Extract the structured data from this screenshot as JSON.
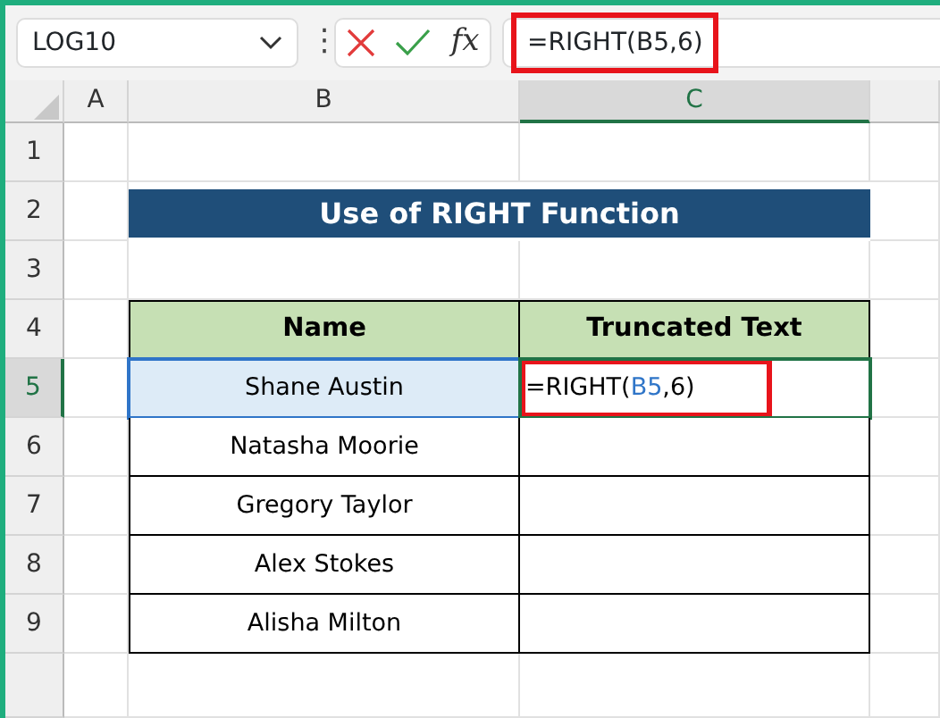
{
  "name_box": {
    "value": "LOG10"
  },
  "formula_bar": {
    "more": "⋮",
    "function_label": "fx",
    "value": "=RIGHT(B5,6)",
    "highlighted": true
  },
  "column_headers": [
    {
      "label": "A",
      "selected": false
    },
    {
      "label": "B",
      "selected": false
    },
    {
      "label": "C",
      "selected": true
    }
  ],
  "row_headers": [
    {
      "label": "1",
      "selected": false
    },
    {
      "label": "2",
      "selected": false
    },
    {
      "label": "3",
      "selected": false
    },
    {
      "label": "4",
      "selected": false
    },
    {
      "label": "5",
      "selected": true
    },
    {
      "label": "6",
      "selected": false
    },
    {
      "label": "7",
      "selected": false
    },
    {
      "label": "8",
      "selected": false
    },
    {
      "label": "9",
      "selected": false
    }
  ],
  "title": "Use of RIGHT Function",
  "table": {
    "columns": [
      "Name",
      "Truncated Text"
    ],
    "rows": [
      {
        "name": "Shane Austin",
        "name_selected": true,
        "truncated": {
          "parts": [
            {
              "text": "=RIGHT("
            },
            {
              "text": "B5",
              "kind": "reference"
            },
            {
              "text": ",6)"
            }
          ],
          "active": true,
          "highlighted": true
        }
      },
      {
        "name": "Natasha Moorie",
        "name_selected": false
      },
      {
        "name": "Gregory Taylor",
        "name_selected": false
      },
      {
        "name": "Alex Stokes",
        "name_selected": false
      },
      {
        "name": "Alisha Milton",
        "name_selected": false
      }
    ]
  }
}
